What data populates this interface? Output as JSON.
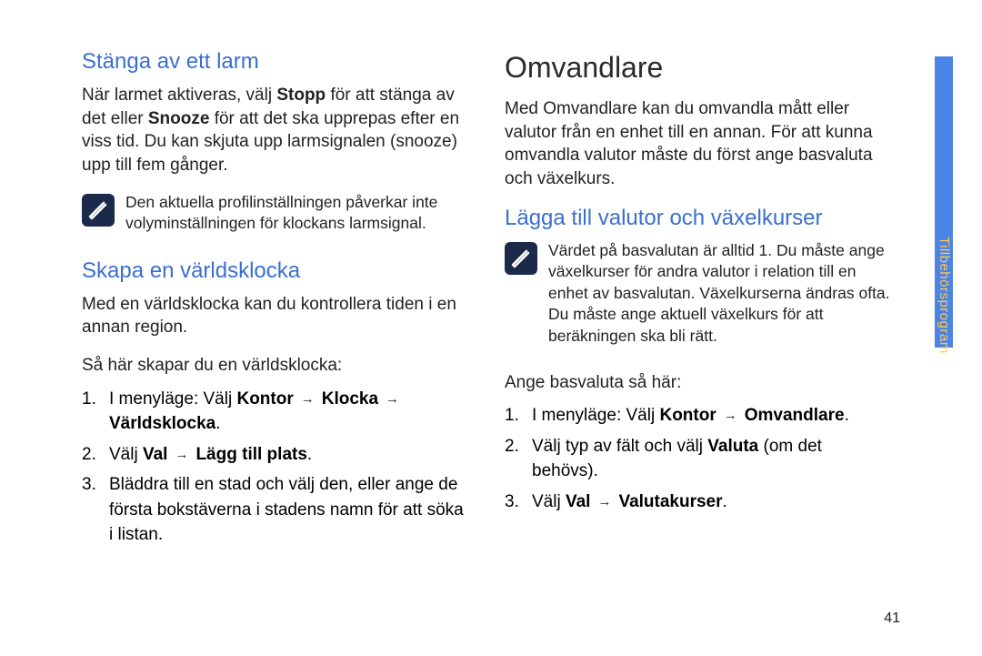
{
  "left": {
    "sec1_title": "Stänga av ett larm",
    "sec1_para_parts": {
      "t1": "När larmet aktiveras, välj ",
      "b1": "Stopp",
      "t2": " för att stänga av det eller ",
      "b2": "Snooze",
      "t3": " för att det ska upprepas efter en viss tid. Du kan skjuta upp larmsignalen (snooze) upp till fem gånger."
    },
    "note1": "Den aktuella profilinställningen påverkar inte volyminställningen för klockans larmsignal.",
    "sec2_title": "Skapa en världsklocka",
    "sec2_para1": "Med en världsklocka kan du kontrollera tiden i en annan region.",
    "sec2_para2": "Så här skapar du en världsklocka:",
    "steps": [
      {
        "t1": "I menyläge: Välj ",
        "b1": "Kontor",
        "b2": "Klocka",
        "b3": "Världsklocka",
        "tail": "."
      },
      {
        "t1": "Välj ",
        "b1": "Val",
        "b2": "Lägg till plats",
        "tail": "."
      },
      {
        "plain": "Bläddra till en stad och välj den, eller ange de första bokstäverna i stadens namn för att söka i listan."
      }
    ]
  },
  "right": {
    "chapter_title": "Omvandlare",
    "intro": "Med Omvandlare kan du omvandla mått eller valutor från en enhet till en annan. För att kunna omvandla valutor måste du först ange basvaluta och växelkurs.",
    "sec1_title": "Lägga till valutor och växelkurser",
    "note1": "Värdet på basvalutan är alltid 1. Du måste ange växelkurser för andra valutor i relation till en enhet av basvalutan. Växelkurserna ändras ofta. Du måste ange aktuell växelkurs för att beräkningen ska bli rätt.",
    "lead": "Ange basvaluta så här:",
    "steps": [
      {
        "t1": "I menyläge: Välj ",
        "b1": "Kontor",
        "b2": "Omvandlare",
        "tail": "."
      },
      {
        "t1": "Välj typ av fält och välj ",
        "b1": "Valuta",
        "tail2": " (om det behövs)."
      },
      {
        "t1": "Välj ",
        "b1": "Val",
        "b2": "Valutakurser",
        "tail": "."
      }
    ]
  },
  "side_label": "Tillbehörsprogram",
  "page_number": "41"
}
